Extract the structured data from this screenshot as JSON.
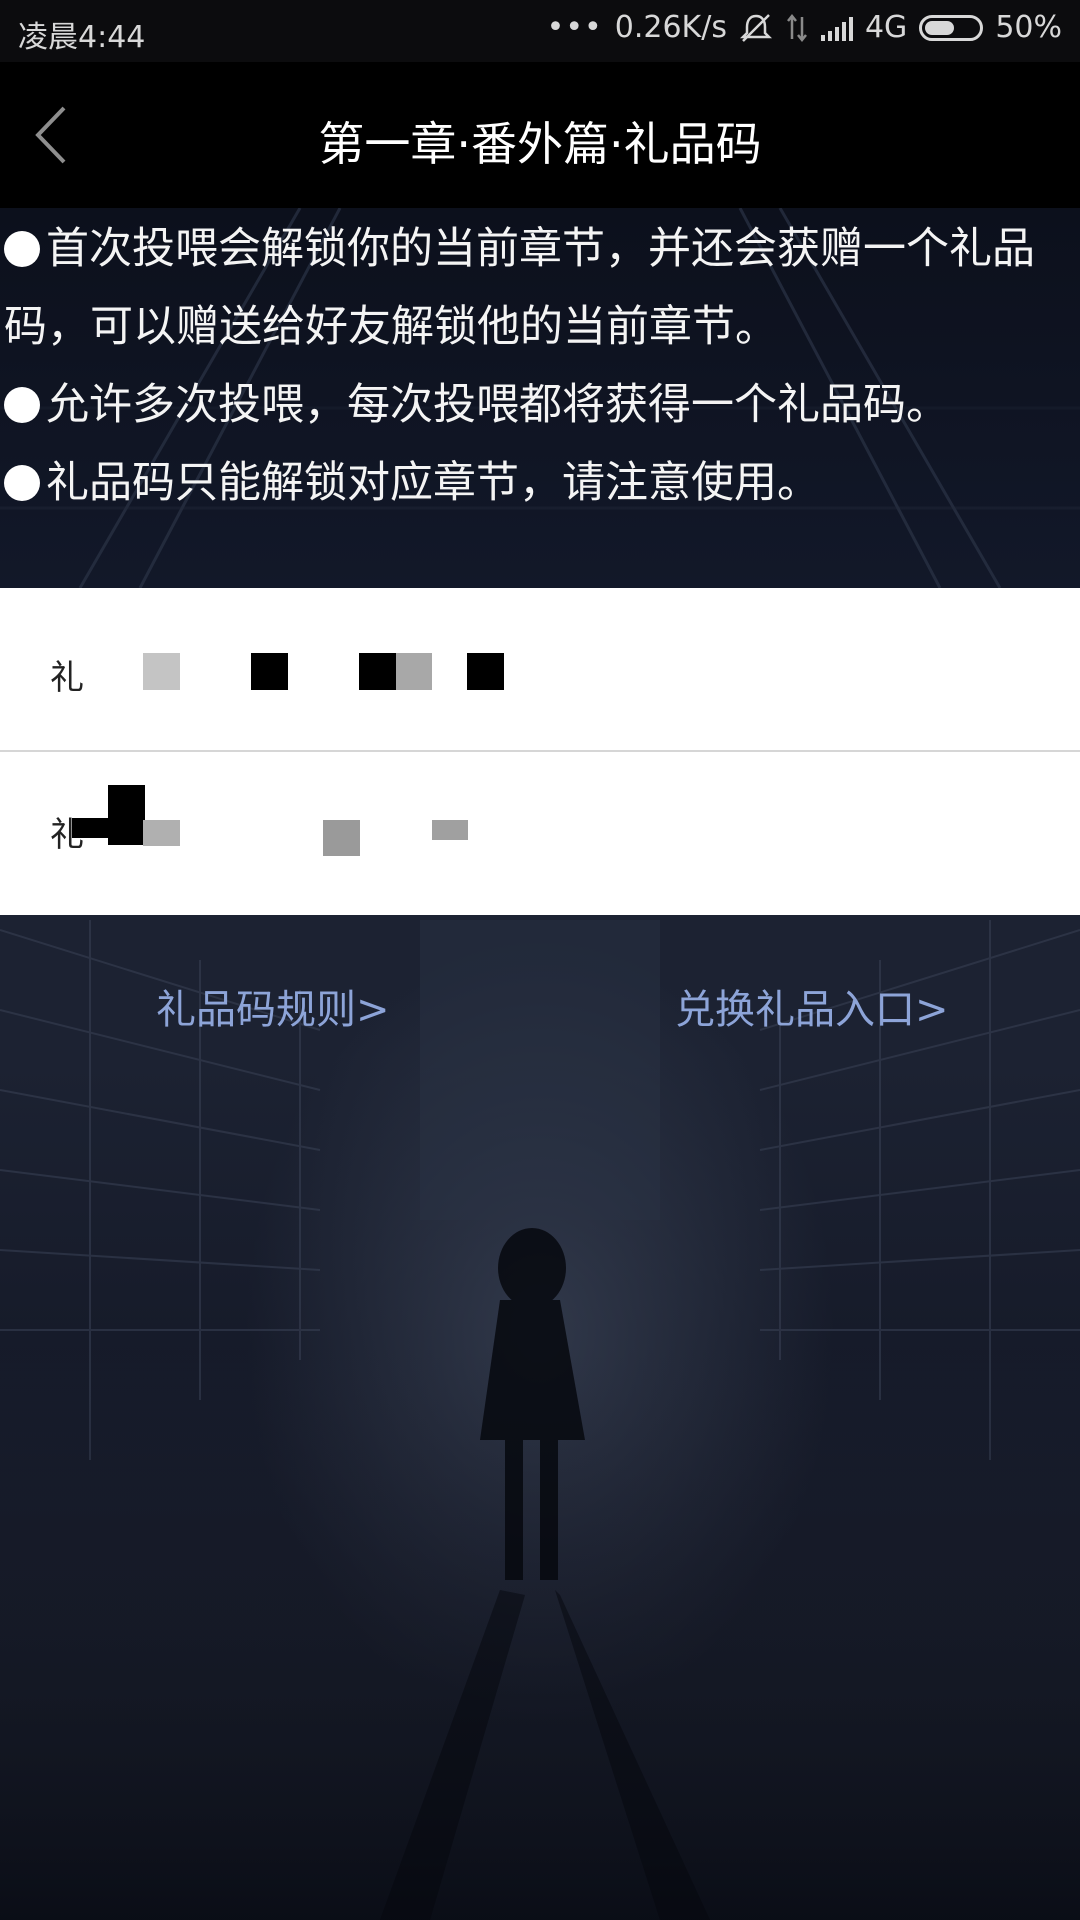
{
  "status_bar": {
    "time": "凌晨4:44",
    "dots": "•••",
    "speed": "0.26K/s",
    "network": "4G",
    "battery": "50%"
  },
  "nav": {
    "title": "第一章·番外篇·礼品码",
    "back_icon": "chevron-left-icon"
  },
  "notes": [
    "首次投喂会解锁你的当前章节，并还会获赠一个礼品码，可以赠送给好友解锁他的当前章节。",
    "允许多次投喂，每次投喂都将获得一个礼品码。",
    "礼品码只能解锁对应章节，请注意使用。"
  ],
  "code_rows": [
    {
      "label": "礼"
    },
    {
      "label": "礼"
    }
  ],
  "links": {
    "rules": "礼品码规则>",
    "redeem": "兑换礼品入口>"
  },
  "colors": {
    "link": "#8da4d8",
    "nav_bg": "#000000",
    "page_bg": "#141a28"
  }
}
